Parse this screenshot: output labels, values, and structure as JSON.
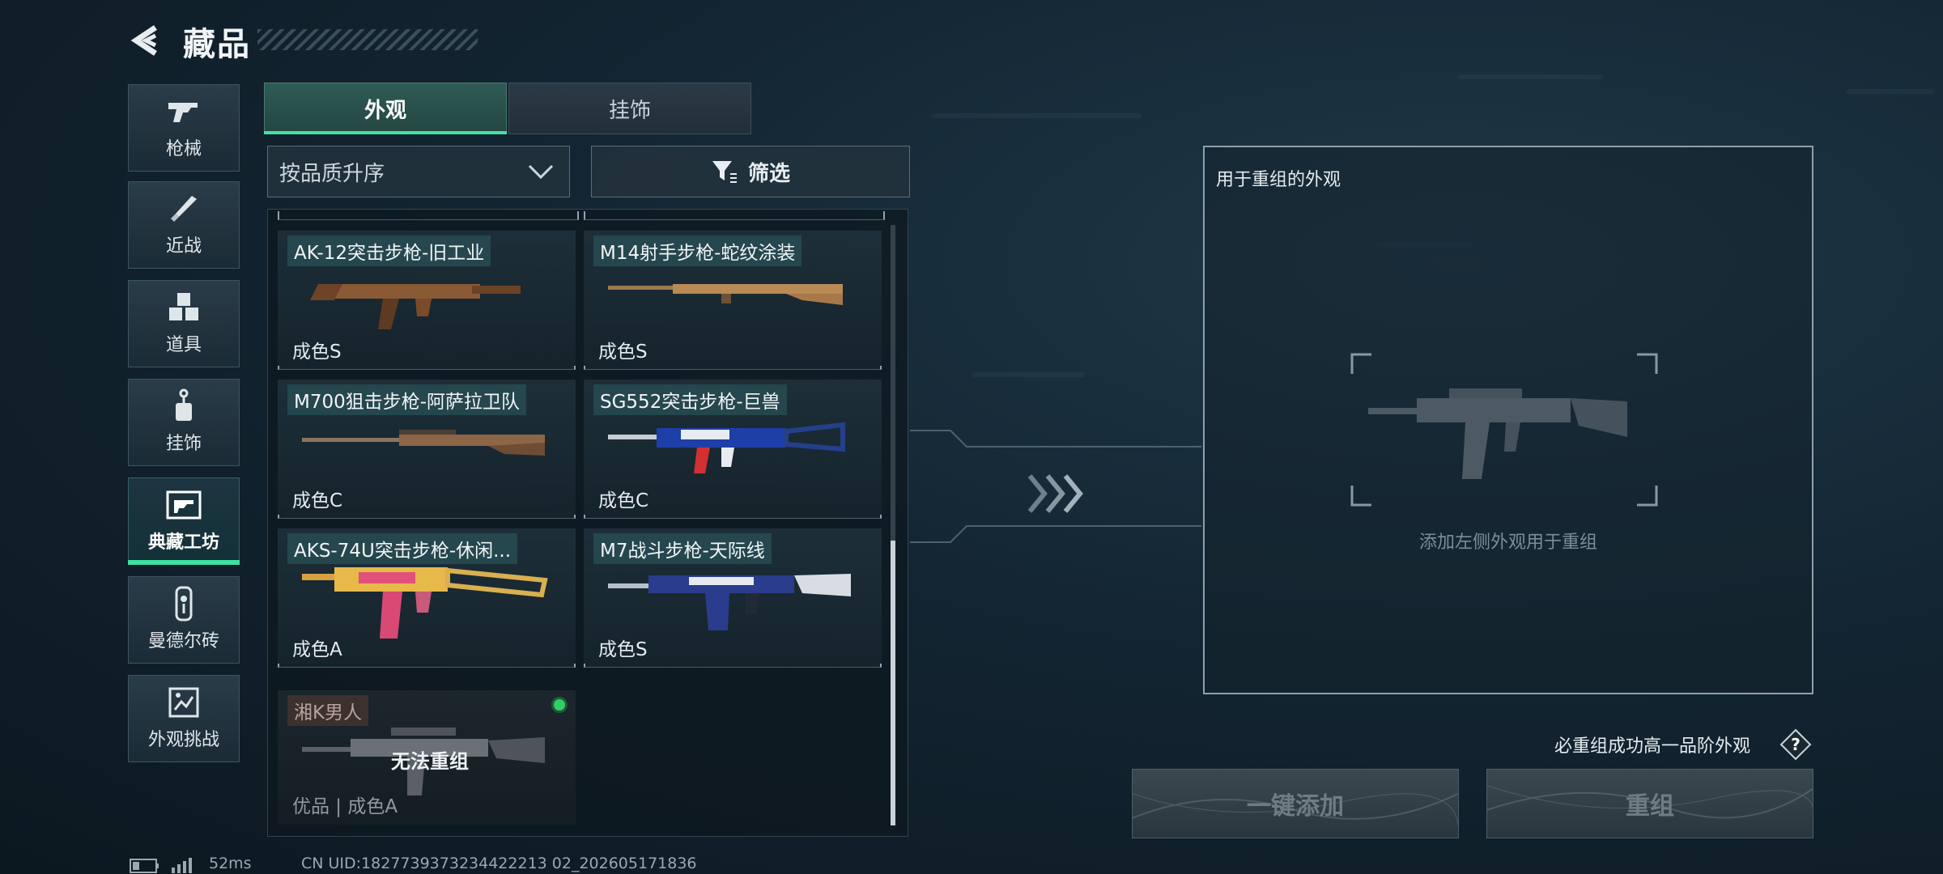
{
  "header": {
    "title": "藏品"
  },
  "sidebar": {
    "items": [
      {
        "label": "枪械",
        "icon": "gun-icon"
      },
      {
        "label": "近战",
        "icon": "knife-icon"
      },
      {
        "label": "道具",
        "icon": "cubes-icon"
      },
      {
        "label": "挂饰",
        "icon": "pendant-icon"
      },
      {
        "label": "典藏工坊",
        "icon": "workshop-icon",
        "active": true
      },
      {
        "label": "曼德尔砖",
        "icon": "brick-icon"
      },
      {
        "label": "外观挑战",
        "icon": "challenge-icon"
      }
    ]
  },
  "tabs": [
    {
      "label": "外观",
      "active": true
    },
    {
      "label": "挂饰",
      "active": false
    }
  ],
  "sort": {
    "label": "按品质升序"
  },
  "filter": {
    "label": "筛选"
  },
  "items": [
    {
      "name": "AK-12突击步枪-旧工业",
      "grade": "成色S"
    },
    {
      "name": "M14射手步枪-蛇纹涂装",
      "grade": "成色S"
    },
    {
      "name": "M700狙击步枪-阿萨拉卫队",
      "grade": "成色C"
    },
    {
      "name": "SG552突击步枪-巨兽",
      "grade": "成色C"
    },
    {
      "name": "AKS-74U突击步枪-休闲...",
      "grade": "成色A"
    },
    {
      "name": "M7战斗步枪-天际线",
      "grade": "成色S"
    },
    {
      "name": "湘K男人",
      "grade": "优品 | 成色A",
      "overlay": "无法重组",
      "equipped": true
    }
  ],
  "reassembly": {
    "title": "用于重组的外观",
    "hint": "添加左侧外观用于重组",
    "guarantee": "必重组成功高一品阶外观",
    "help": "?",
    "btn_add": "一键添加",
    "btn_reassemble": "重组"
  },
  "footer": {
    "ping": "52ms",
    "uid": "CN UID:1827739373234422213 02_202605171836"
  },
  "colors": {
    "accent": "#43e2a4",
    "active_tab": "#2f5b56",
    "panel_border": "#8ea0ab"
  }
}
